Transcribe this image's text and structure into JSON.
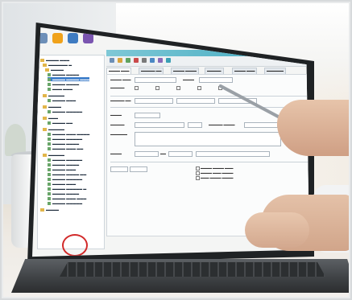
{
  "scene": {
    "subject": "laptop showing desktop application",
    "colors": {
      "screen_bezel": "#1f2224",
      "sidebar_selection": "#3b7cc9",
      "header_teal": "#3da8bf",
      "logo_red": "#d22a2a"
    }
  },
  "toolbar": {
    "icons": [
      "home-icon",
      "gear-icon",
      "folder-icon",
      "user-icon"
    ],
    "labels": [
      "",
      "",
      "",
      ""
    ]
  },
  "logo": {
    "text": "",
    "icon": "heart-icon"
  }
}
